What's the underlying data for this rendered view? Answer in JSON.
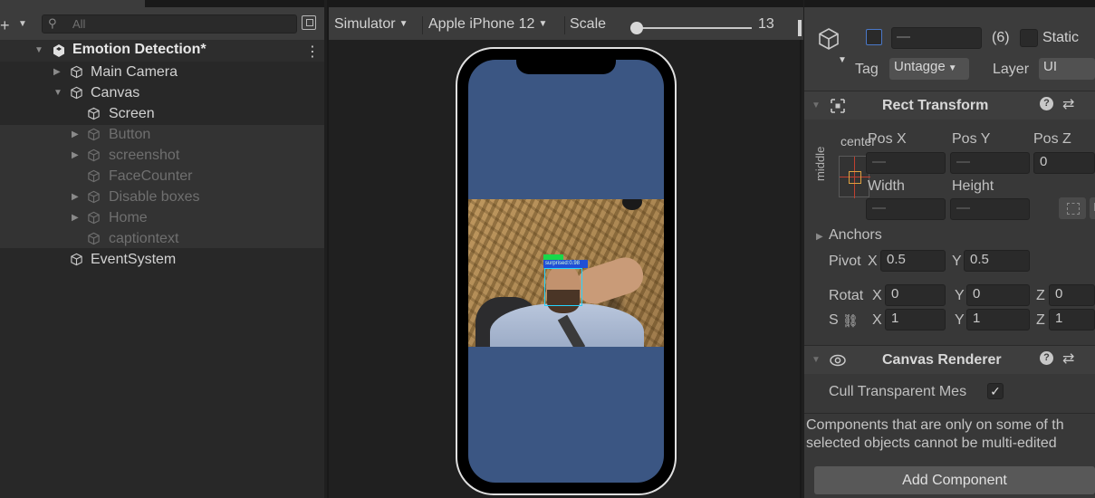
{
  "hierarchy": {
    "search_placeholder": "All",
    "scene": {
      "label": "Emotion Detection*"
    },
    "items": [
      {
        "label": "Main Camera"
      },
      {
        "label": "Canvas"
      },
      {
        "label": "Screen"
      },
      {
        "label": "Button"
      },
      {
        "label": "screenshot"
      },
      {
        "label": "FaceCounter"
      },
      {
        "label": "Disable boxes"
      },
      {
        "label": "Home"
      },
      {
        "label": "captiontext"
      },
      {
        "label": "EventSystem"
      }
    ]
  },
  "simulator": {
    "mode_label": "Simulator",
    "device_label": "Apple iPhone 12",
    "scale_label": "Scale",
    "scale_value": "13",
    "scale_fraction": 0.05,
    "face_box_label": "surprised:0.98"
  },
  "inspector": {
    "object_name": "—",
    "layer_count": "(6)",
    "static_label": "Static",
    "tag_label": "Tag",
    "tag_value": "Untagge",
    "layer_label": "Layer",
    "layer_value": "UI",
    "rect_transform": {
      "title": "Rect Transform",
      "anchor_h_label": "center",
      "anchor_v_label": "middle",
      "pos_x_label": "Pos X",
      "pos_y_label": "Pos Y",
      "pos_z_label": "Pos Z",
      "pos_x_value": "—",
      "pos_y_value": "—",
      "pos_z_value": "0",
      "width_label": "Width",
      "height_label": "Height",
      "width_value": "—",
      "height_value": "—",
      "raw_btn_label": "R",
      "anchors_label": "Anchors",
      "pivot_label": "Pivot",
      "pivot_x_label": "X",
      "pivot_x_value": "0.5",
      "pivot_y_label": "Y",
      "pivot_y_value": "0.5",
      "rotation_label": "Rotat",
      "rot_x_label": "X",
      "rot_x_value": "0",
      "rot_y_label": "Y",
      "rot_y_value": "0",
      "rot_z_label": "Z",
      "rot_z_value": "0",
      "scale_label": "S",
      "scale_x_label": "X",
      "scale_x_value": "1",
      "scale_y_label": "Y",
      "scale_y_value": "1",
      "scale_z_label": "Z",
      "scale_z_value": "1"
    },
    "canvas_renderer": {
      "title": "Canvas Renderer",
      "cull_label": "Cull Transparent Mes",
      "cull_checked": "✓"
    },
    "multi_edit_note_line1": "Components that are only on some of th",
    "multi_edit_note_line2": "selected objects cannot be multi-edited",
    "add_component_label": "Add Component"
  }
}
